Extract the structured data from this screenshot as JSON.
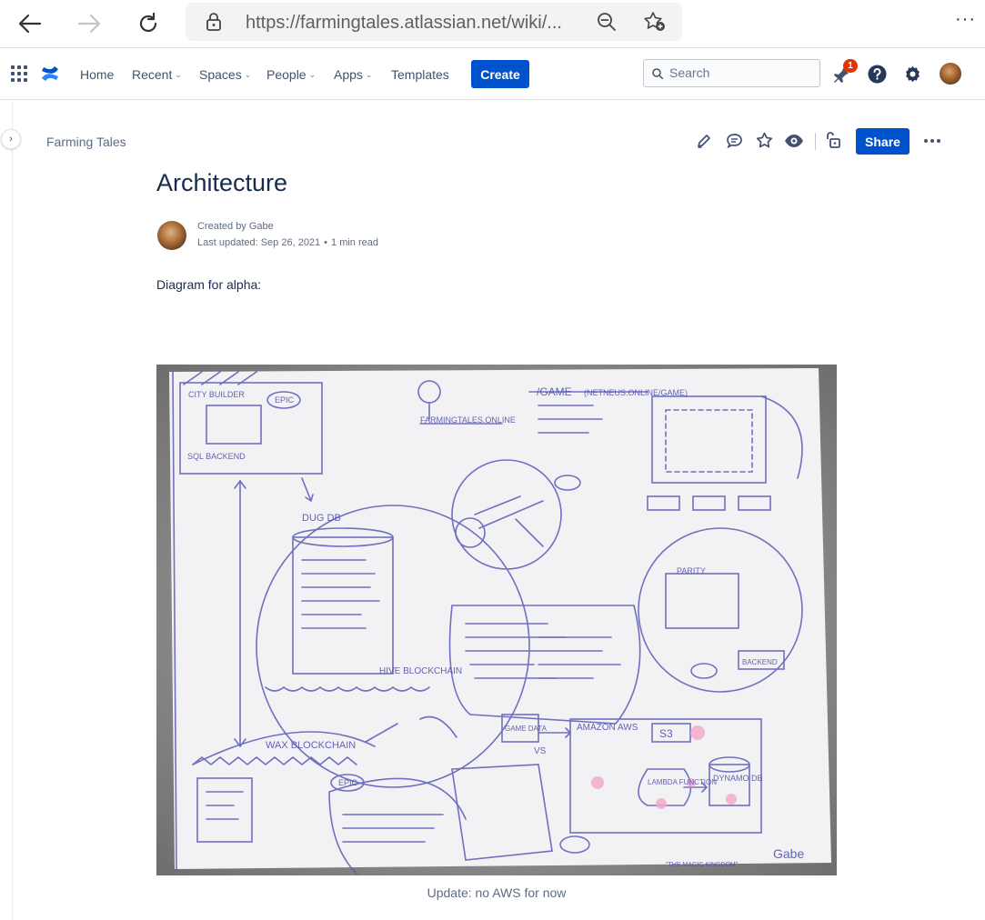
{
  "browser": {
    "url": "https://farmingtales.atlassian.net/wiki/...",
    "more_label": "···"
  },
  "nav": {
    "items": [
      "Home",
      "Recent",
      "Spaces",
      "People",
      "Apps",
      "Templates"
    ],
    "create_label": "Create",
    "search_placeholder": "Search",
    "notification_count": "1"
  },
  "page": {
    "space": "Farming Tales",
    "share_label": "Share",
    "title": "Architecture",
    "created_by": "Created by Gabe",
    "last_updated": "Last updated: Sep 26, 2021",
    "separator": "•",
    "read_time": "1 min read",
    "intro": "Diagram for alpha:",
    "caption": "Update: no AWS for now"
  },
  "diagram_text": [
    "CITY BUILDER",
    "EPIC",
    "SQL BACKEND",
    "FARMINGTALES.ONLINE",
    "/GAME",
    "(NETNEUS.ONLINE/GAME)",
    "DUG DB",
    "HIVE BLOCKCHAIN",
    "WAX BLOCKCHAIN",
    "S3",
    "DYNAMO DB",
    "LAMBDA FUNCTION",
    "AMAZON AWS",
    "GAME DATA",
    "VS",
    "EPIC",
    "PARITY",
    "BACKEND",
    "Gabe",
    "\"THE MAGIC KINGDOM\""
  ],
  "colors": {
    "accent": "#0052cc",
    "badge": "#de350b",
    "ink": "#4a4aa8"
  }
}
